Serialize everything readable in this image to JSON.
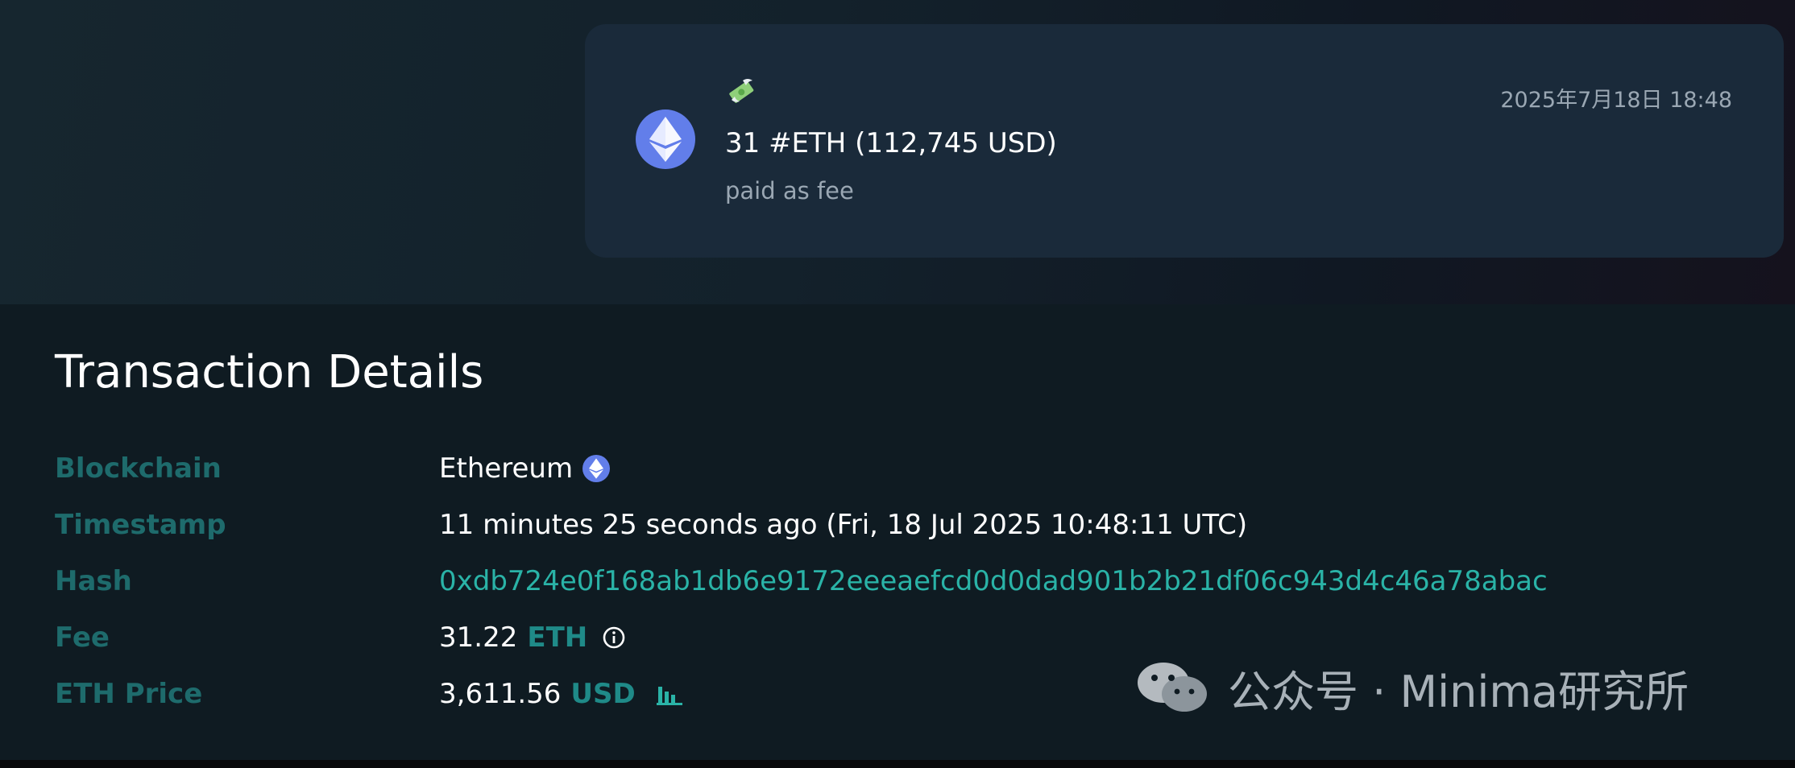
{
  "message": {
    "emoji": "money-with-wings",
    "amount_text": "31 #ETH (112,745 USD)",
    "subtitle": "paid as fee",
    "timestamp": "2025年7月18日 18:48",
    "icon": "ethereum-icon"
  },
  "details": {
    "title": "Transaction Details",
    "rows": [
      {
        "label": "Blockchain",
        "value": "Ethereum"
      },
      {
        "label": "Timestamp",
        "value": "11 minutes 25 seconds ago (Fri, 18 Jul 2025 10:48:11 UTC)"
      },
      {
        "label": "Hash",
        "value": "0xdb724e0f168ab1db6e9172eeeaefcd0d0dad901b2b21df06c943d4c46a78abac"
      },
      {
        "label": "Fee",
        "value": "31.22",
        "unit": "ETH"
      },
      {
        "label": "ETH Price",
        "value": "3,611.56",
        "unit": "USD"
      }
    ]
  },
  "watermark": {
    "text": "公众号 · Minima研究所",
    "icon": "wechat-icon"
  },
  "colors": {
    "label": "#1e6b6c",
    "link": "#2ab3a7",
    "unit": "#1f8a88",
    "card": "#1a2a3a",
    "ethereum": "#627eea"
  }
}
